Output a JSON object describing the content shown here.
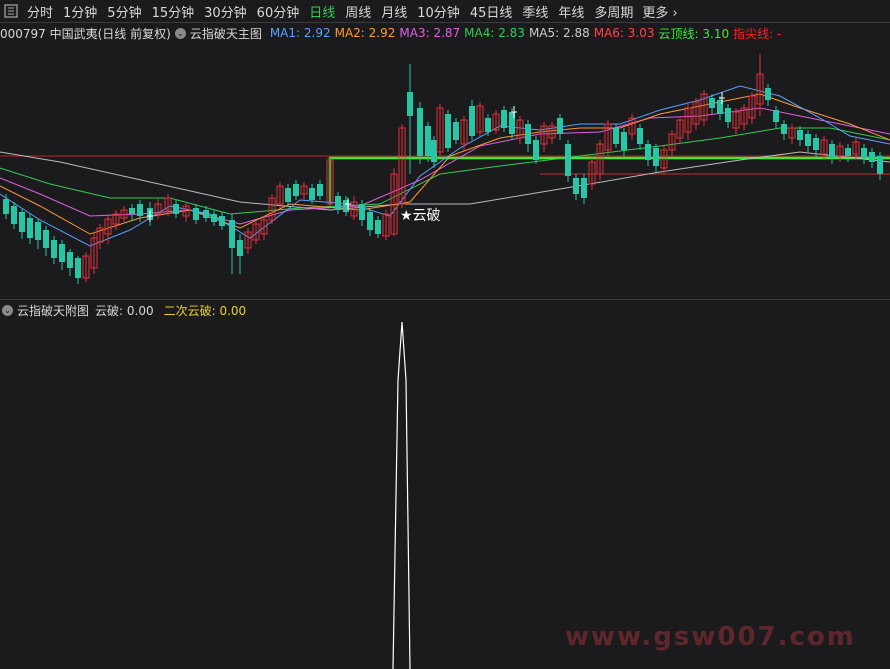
{
  "toolbar": {
    "tabs": [
      "分时",
      "1分钟",
      "5分钟",
      "15分钟",
      "30分钟",
      "60分钟",
      "日线",
      "周线",
      "月线",
      "10分钟",
      "45日线",
      "季线",
      "年线",
      "多周期"
    ],
    "active_index": 6,
    "more_label": "更多",
    "more_icon": "chevron-right-icon",
    "menu_icon": "grid-menu-icon"
  },
  "main_info": {
    "stock": "000797 中国武夷(日线 前复权)",
    "indicator": "云指破天主图",
    "ma": [
      {
        "label": "MA1: 2.92",
        "color": "#5aa0ff"
      },
      {
        "label": "MA2: 2.92",
        "color": "#ff9933"
      },
      {
        "label": "MA3: 2.87",
        "color": "#e060e0"
      },
      {
        "label": "MA4: 2.83",
        "color": "#33cc55"
      },
      {
        "label": "MA5: 2.88",
        "color": "#cccccc"
      },
      {
        "label": "MA6: 3.03",
        "color": "#ff4444"
      },
      {
        "label": "云顶线: 3.10",
        "color": "#33ee33"
      },
      {
        "label": "指尖线: -",
        "color": "#ff2222"
      }
    ]
  },
  "annotation": "★云破",
  "sub_info": {
    "indicator": "云指破天附图",
    "yunpo": "云破: 0.00",
    "second": "二次云破: 0.00",
    "second_color": "#e8d22a"
  },
  "watermark": "www.gsw007.com",
  "colors": {
    "up": "#e0323c",
    "down": "#26c6a6",
    "cloud": "#33ee33"
  }
}
